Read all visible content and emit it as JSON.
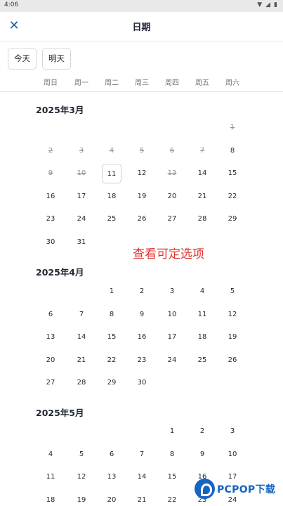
{
  "status": {
    "time": "4:06",
    "icons": [
      "wifi-icon",
      "signal-icon",
      "battery-icon"
    ]
  },
  "header": {
    "title": "日期",
    "close_icon": "close-icon"
  },
  "quick": {
    "today": "今天",
    "tomorrow": "明天"
  },
  "weekdays": [
    "周日",
    "周一",
    "周二",
    "周三",
    "周四",
    "周五",
    "周六"
  ],
  "months": [
    {
      "title": "2025年3月",
      "weeks": [
        [
          {
            "d": "",
            "s": ""
          },
          {
            "d": "",
            "s": ""
          },
          {
            "d": "",
            "s": ""
          },
          {
            "d": "",
            "s": ""
          },
          {
            "d": "",
            "s": ""
          },
          {
            "d": "",
            "s": ""
          },
          {
            "d": "1",
            "s": "disabled"
          }
        ],
        [
          {
            "d": "2",
            "s": "disabled"
          },
          {
            "d": "3",
            "s": "disabled"
          },
          {
            "d": "4",
            "s": "disabled"
          },
          {
            "d": "5",
            "s": "disabled"
          },
          {
            "d": "6",
            "s": "disabled"
          },
          {
            "d": "7",
            "s": "disabled"
          },
          {
            "d": "8",
            "s": ""
          }
        ],
        [
          {
            "d": "9",
            "s": "disabled"
          },
          {
            "d": "10",
            "s": "disabled"
          },
          {
            "d": "11",
            "s": "selected"
          },
          {
            "d": "12",
            "s": ""
          },
          {
            "d": "13",
            "s": "disabled"
          },
          {
            "d": "14",
            "s": ""
          },
          {
            "d": "15",
            "s": ""
          }
        ],
        [
          {
            "d": "16",
            "s": ""
          },
          {
            "d": "17",
            "s": ""
          },
          {
            "d": "18",
            "s": ""
          },
          {
            "d": "19",
            "s": ""
          },
          {
            "d": "20",
            "s": ""
          },
          {
            "d": "21",
            "s": ""
          },
          {
            "d": "22",
            "s": ""
          }
        ],
        [
          {
            "d": "23",
            "s": ""
          },
          {
            "d": "24",
            "s": ""
          },
          {
            "d": "25",
            "s": ""
          },
          {
            "d": "26",
            "s": ""
          },
          {
            "d": "27",
            "s": ""
          },
          {
            "d": "28",
            "s": ""
          },
          {
            "d": "29",
            "s": ""
          }
        ],
        [
          {
            "d": "30",
            "s": ""
          },
          {
            "d": "31",
            "s": ""
          },
          {
            "d": "",
            "s": ""
          },
          {
            "d": "",
            "s": ""
          },
          {
            "d": "",
            "s": ""
          },
          {
            "d": "",
            "s": ""
          },
          {
            "d": "",
            "s": ""
          }
        ]
      ]
    },
    {
      "title": "2025年4月",
      "weeks": [
        [
          {
            "d": "",
            "s": ""
          },
          {
            "d": "",
            "s": ""
          },
          {
            "d": "1",
            "s": ""
          },
          {
            "d": "2",
            "s": ""
          },
          {
            "d": "3",
            "s": ""
          },
          {
            "d": "4",
            "s": ""
          },
          {
            "d": "5",
            "s": ""
          }
        ],
        [
          {
            "d": "6",
            "s": ""
          },
          {
            "d": "7",
            "s": ""
          },
          {
            "d": "8",
            "s": ""
          },
          {
            "d": "9",
            "s": ""
          },
          {
            "d": "10",
            "s": ""
          },
          {
            "d": "11",
            "s": ""
          },
          {
            "d": "12",
            "s": ""
          }
        ],
        [
          {
            "d": "13",
            "s": ""
          },
          {
            "d": "14",
            "s": ""
          },
          {
            "d": "15",
            "s": ""
          },
          {
            "d": "16",
            "s": ""
          },
          {
            "d": "17",
            "s": ""
          },
          {
            "d": "18",
            "s": ""
          },
          {
            "d": "19",
            "s": ""
          }
        ],
        [
          {
            "d": "20",
            "s": ""
          },
          {
            "d": "21",
            "s": ""
          },
          {
            "d": "22",
            "s": ""
          },
          {
            "d": "23",
            "s": ""
          },
          {
            "d": "24",
            "s": ""
          },
          {
            "d": "25",
            "s": ""
          },
          {
            "d": "26",
            "s": ""
          }
        ],
        [
          {
            "d": "27",
            "s": ""
          },
          {
            "d": "28",
            "s": ""
          },
          {
            "d": "29",
            "s": ""
          },
          {
            "d": "30",
            "s": ""
          },
          {
            "d": "",
            "s": ""
          },
          {
            "d": "",
            "s": ""
          },
          {
            "d": "",
            "s": ""
          }
        ]
      ]
    },
    {
      "title": "2025年5月",
      "weeks": [
        [
          {
            "d": "",
            "s": ""
          },
          {
            "d": "",
            "s": ""
          },
          {
            "d": "",
            "s": ""
          },
          {
            "d": "",
            "s": ""
          },
          {
            "d": "1",
            "s": ""
          },
          {
            "d": "2",
            "s": ""
          },
          {
            "d": "3",
            "s": ""
          }
        ],
        [
          {
            "d": "4",
            "s": ""
          },
          {
            "d": "5",
            "s": ""
          },
          {
            "d": "6",
            "s": ""
          },
          {
            "d": "7",
            "s": ""
          },
          {
            "d": "8",
            "s": ""
          },
          {
            "d": "9",
            "s": ""
          },
          {
            "d": "10",
            "s": ""
          }
        ],
        [
          {
            "d": "11",
            "s": ""
          },
          {
            "d": "12",
            "s": ""
          },
          {
            "d": "13",
            "s": ""
          },
          {
            "d": "14",
            "s": ""
          },
          {
            "d": "15",
            "s": ""
          },
          {
            "d": "16",
            "s": ""
          },
          {
            "d": "17",
            "s": ""
          }
        ],
        [
          {
            "d": "18",
            "s": ""
          },
          {
            "d": "19",
            "s": ""
          },
          {
            "d": "20",
            "s": ""
          },
          {
            "d": "21",
            "s": ""
          },
          {
            "d": "22",
            "s": ""
          },
          {
            "d": "23",
            "s": ""
          },
          {
            "d": "24",
            "s": ""
          }
        ]
      ]
    }
  ],
  "annotation": {
    "text": "查看可定选项",
    "color": "#e0332c"
  },
  "watermark": {
    "text": "PCPOP下载"
  },
  "colors": {
    "accent": "#1f5fb0",
    "text": "#1f2633",
    "disabled": "#8d939c"
  }
}
